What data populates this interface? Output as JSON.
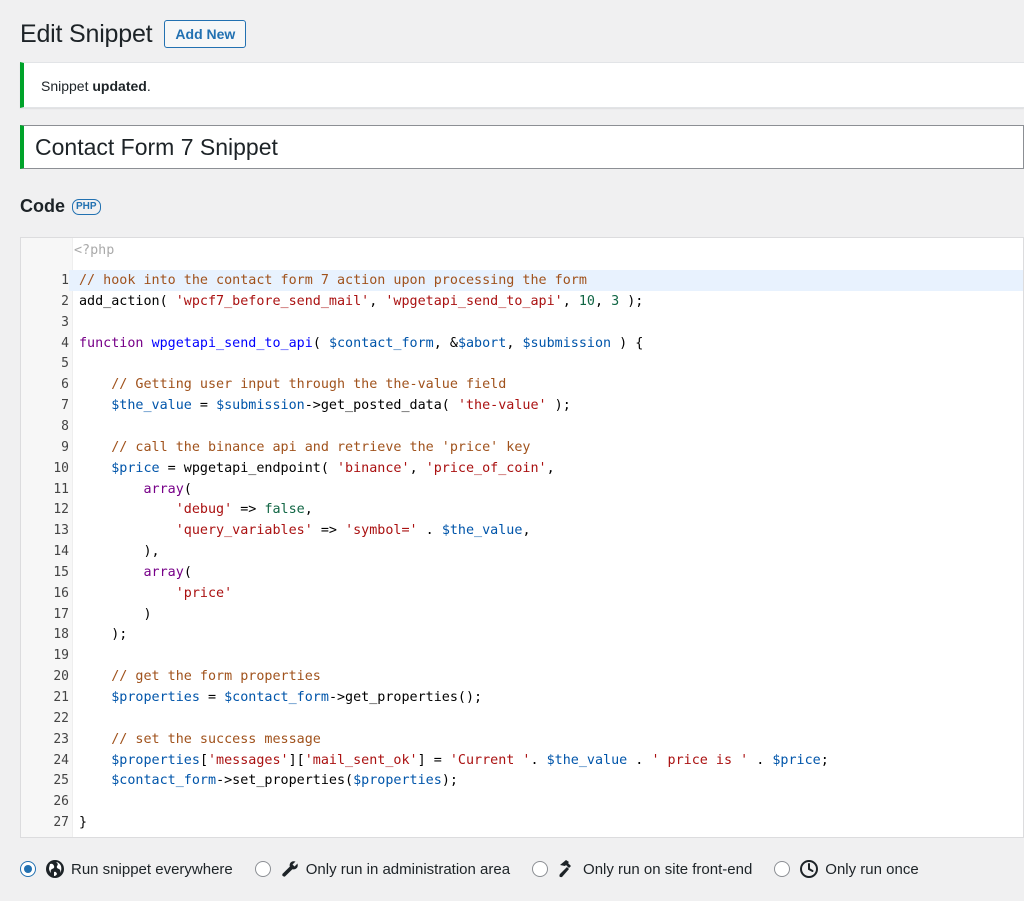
{
  "header": {
    "title": "Edit Snippet",
    "add_new_label": "Add New"
  },
  "notice": {
    "prefix": "Snippet ",
    "bold": "updated",
    "suffix": "."
  },
  "snippet": {
    "name": "Contact Form 7 Snippet"
  },
  "code_section": {
    "title": "Code",
    "badge": "PHP"
  },
  "editor": {
    "placeholder": "<?php",
    "active_line": 1,
    "line_numbers": [
      "1",
      "2",
      "3",
      "4",
      "5",
      "6",
      "7",
      "8",
      "9",
      "10",
      "11",
      "12",
      "13",
      "14",
      "15",
      "16",
      "17",
      "18",
      "19",
      "20",
      "21",
      "22",
      "23",
      "24",
      "25",
      "26",
      "27"
    ],
    "lines": [
      "// hook into the contact form 7 action upon processing the form",
      "add_action( 'wpcf7_before_send_mail', 'wpgetapi_send_to_api', 10, 3 );",
      "",
      "function wpgetapi_send_to_api( $contact_form, &$abort, $submission ) {",
      "",
      "    // Getting user input through the the-value field",
      "    $the_value = $submission->get_posted_data( 'the-value' );",
      "",
      "    // call the binance api and retrieve the 'price' key",
      "    $price = wpgetapi_endpoint( 'binance', 'price_of_coin',",
      "        array(",
      "            'debug' => false,",
      "            'query_variables' => 'symbol=' . $the_value,",
      "        ),",
      "        array(",
      "            'price'",
      "        )",
      "    );",
      "",
      "    // get the form properties",
      "    $properties = $contact_form->get_properties();",
      "",
      "    // set the success message",
      "    $properties['messages']['mail_sent_ok'] = 'Current '. $the_value . ' price is ' . $price;",
      "    $contact_form->set_properties($properties);",
      "",
      "}"
    ]
  },
  "scope_options": {
    "selected": "everywhere",
    "items": [
      {
        "id": "everywhere",
        "label": "Run snippet everywhere",
        "icon": "globe-icon"
      },
      {
        "id": "admin",
        "label": "Only run in administration area",
        "icon": "wrench-icon"
      },
      {
        "id": "front",
        "label": "Only run on site front-end",
        "icon": "hammer-icon"
      },
      {
        "id": "once",
        "label": "Only run once",
        "icon": "clock-icon"
      }
    ]
  }
}
